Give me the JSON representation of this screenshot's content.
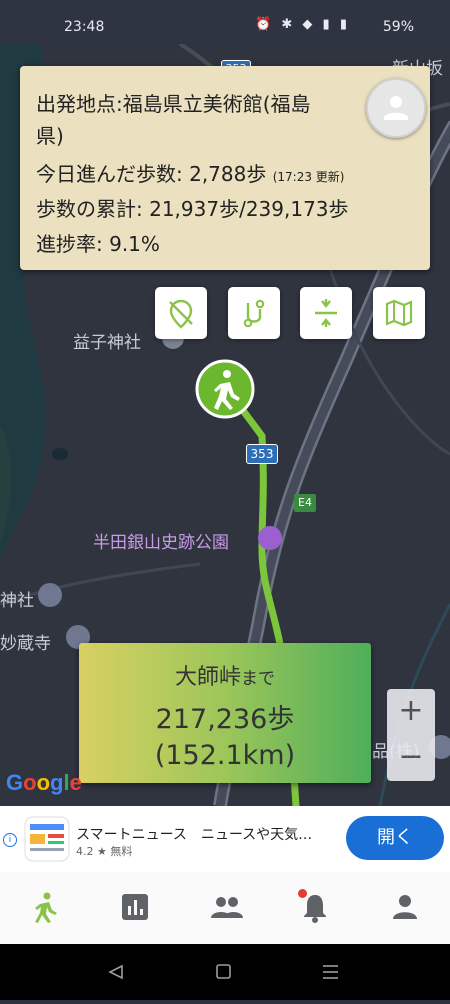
{
  "status_bar": {
    "time": "23:48",
    "battery": "59%"
  },
  "info_card": {
    "origin_label": "出発地点:福島県立美術館(福島",
    "origin_label_cont": "県)",
    "today_steps": "今日進んだ歩数: 2,788歩",
    "updated": "(17:23 更新)",
    "total_steps": "歩数の累計: 21,937歩/239,173歩",
    "progress": "進捗率: 9.1%",
    "progress_percent": 9.1
  },
  "map": {
    "labels": {
      "shinyamazaka": "新山坂",
      "route353_a": "353",
      "route353_b": "353",
      "e4": "E4",
      "mashiko_shrine": "益子神社",
      "handa_park": "半田銀山史跡公園",
      "jinja": "神社",
      "myozoji": "妙蔵寺",
      "hin_kabu": "品(株)"
    }
  },
  "destination_card": {
    "place": "大師峠",
    "suffix": "まで",
    "steps": "217,236歩",
    "distance": "(152.1km)"
  },
  "zoom": {
    "plus": "+",
    "minus": "−"
  },
  "google_logo": "Google",
  "ad": {
    "title": "スマートニュース　ニュースや天気…",
    "rating": "4.2 ★ 無料",
    "open_button": "開く"
  },
  "colors": {
    "route": "#7bc63a",
    "walker_marker": "#6bb82e",
    "card_bg": "#ebe0c0",
    "nav_active": "#8bc34a",
    "ad_button": "#1a6fd6"
  },
  "icons": [
    "walking-icon",
    "bar-chart-icon",
    "group-icon",
    "bell-icon",
    "person-icon"
  ]
}
